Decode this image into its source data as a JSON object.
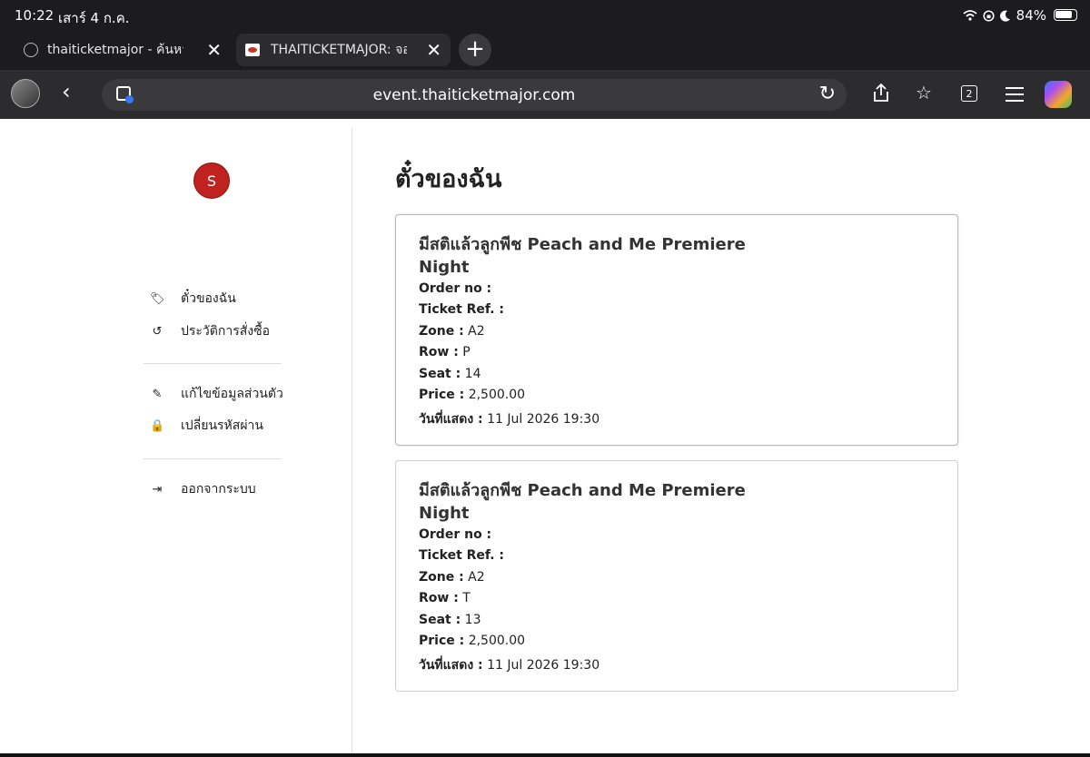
{
  "status_bar": {
    "time": "10:22",
    "date": "เสาร์ 4 ก.ค.",
    "battery": "84%"
  },
  "tabs": [
    {
      "title": "thaiticketmajor - ค้นหา",
      "active": false
    },
    {
      "title": "THAITICKETMAJOR: จองตั๋",
      "active": true
    }
  ],
  "new_tab_label": "+",
  "toolbar": {
    "url": "event.thaiticketmajor.com",
    "tab_count": "2"
  },
  "user": {
    "initial": "S"
  },
  "sidebar": {
    "items": [
      {
        "label": "ตั๋วของฉัน",
        "icon": "ticket-icon"
      },
      {
        "label": "ประวัติการสั่งซื้อ",
        "icon": "history-icon"
      },
      {
        "label": "แก้ไขข้อมูลส่วนตัว",
        "icon": "pencil-icon"
      },
      {
        "label": "เปลี่ยนรหัสผ่าน",
        "icon": "lock-icon"
      },
      {
        "label": "ออกจากระบบ",
        "icon": "sign-out-icon"
      }
    ]
  },
  "main": {
    "heading": "ตั๋วของฉัน",
    "labels": {
      "order_no": "Order no :",
      "ticket_ref": "Ticket Ref. :",
      "zone": "Zone :",
      "row": "Row :",
      "seat": "Seat :",
      "price": "Price :",
      "show_date": "วันที่แสดง :"
    },
    "tickets": [
      {
        "event": "มีสติแล้วลูกพีช Peach and Me Premiere Night",
        "order_no": "",
        "ticket_ref": "",
        "zone": "A2",
        "row": "P",
        "seat": "14",
        "price": "2,500.00",
        "show_date": "11 Jul 2026 19:30"
      },
      {
        "event": "มีสติแล้วลูกพีช Peach and Me Premiere Night",
        "order_no": "",
        "ticket_ref": "",
        "zone": "A2",
        "row": "T",
        "seat": "13",
        "price": "2,500.00",
        "show_date": "11 Jul 2026 19:30"
      }
    ]
  }
}
